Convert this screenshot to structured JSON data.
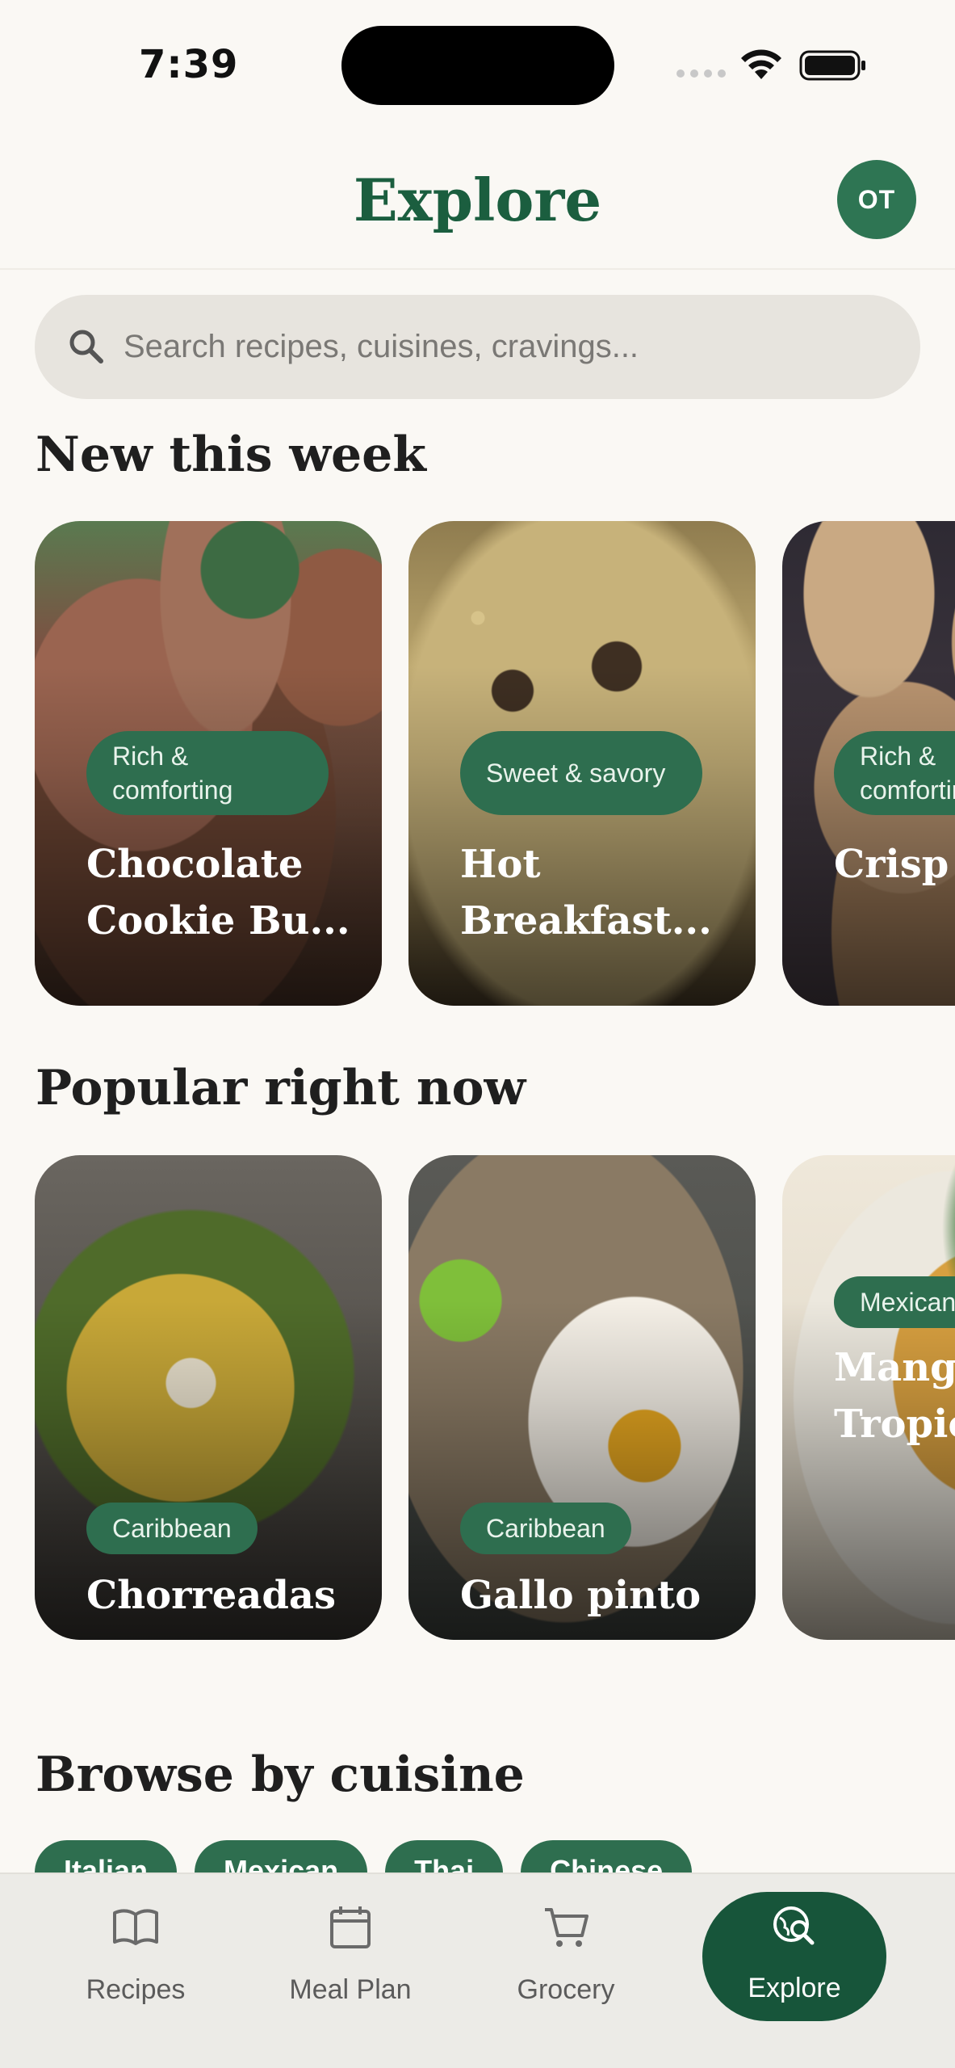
{
  "status_bar": {
    "time": "7:39"
  },
  "header": {
    "title": "Explore",
    "avatar_initials": "OT"
  },
  "search": {
    "placeholder": "Search recipes, cuisines, cravings..."
  },
  "sections": {
    "new_this_week": {
      "title": "New this week",
      "cards": [
        {
          "tag": "Rich & comforting",
          "title": "Chocolate Cookie Bu..."
        },
        {
          "tag": "Sweet & savory",
          "title": "Hot Breakfast..."
        },
        {
          "tag": "Rich & comforting",
          "title": "Crisp Oatme"
        }
      ]
    },
    "popular_right_now": {
      "title": "Popular right now",
      "cards": [
        {
          "tag": "Caribbean",
          "title": "Chorreadas"
        },
        {
          "tag": "Caribbean",
          "title": "Gallo pinto"
        },
        {
          "tag": "Mexican",
          "title": "Mango Tropic"
        }
      ]
    },
    "browse_by_cuisine": {
      "title": "Browse by cuisine",
      "chips": [
        "Italian",
        "Mexican",
        "Thai",
        "Chinese"
      ]
    }
  },
  "bottom_nav": {
    "items": [
      {
        "label": "Recipes",
        "icon": "book-icon"
      },
      {
        "label": "Meal Plan",
        "icon": "calendar-icon"
      },
      {
        "label": "Grocery",
        "icon": "cart-icon"
      },
      {
        "label": "Explore",
        "icon": "explore-icon",
        "active": true
      }
    ]
  },
  "colors": {
    "brand": "#1b5e3f",
    "tag": "#2e6e4f",
    "active_nav": "#17553a",
    "background": "#faf8f4"
  }
}
